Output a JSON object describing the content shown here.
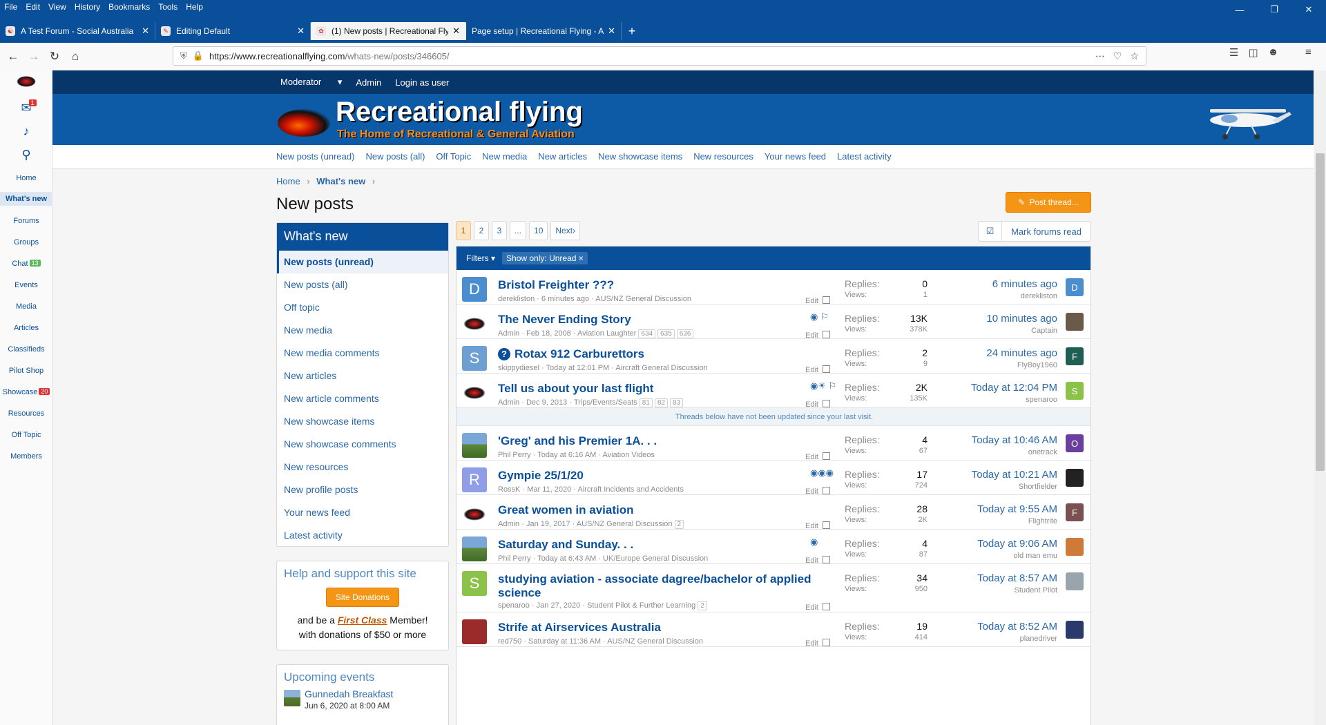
{
  "browser": {
    "menu": [
      "File",
      "Edit",
      "View",
      "History",
      "Bookmarks",
      "Tools",
      "Help"
    ],
    "tabs": [
      {
        "title": "A Test Forum - Social Australia"
      },
      {
        "title": "Editing Default"
      },
      {
        "title": "(1) New posts | Recreational Fly"
      },
      {
        "title": "Page setup | Recreational Flying - A"
      }
    ],
    "url_host": "https://www.recreationalflying.com",
    "url_path": "/whats-new/posts/346605/"
  },
  "rail": {
    "items": [
      "Home",
      "What's new",
      "Forums",
      "Groups",
      "Chat",
      "Events",
      "Media",
      "Articles",
      "Classifieds",
      "Pilot Shop",
      "Showcase",
      "Resources",
      "Off Topic",
      "Members"
    ],
    "chat_badge": "13",
    "showcase_badge": "20",
    "mail_badge": "1"
  },
  "site": {
    "top_links": [
      "Moderator",
      "Admin",
      "Login as user"
    ],
    "logo_title": "Recreational flying",
    "logo_sub": "The Home of Recreational & General Aviation",
    "subnav": [
      "New posts (unread)",
      "New posts (all)",
      "Off Topic",
      "New media",
      "New articles",
      "New showcase items",
      "New resources",
      "Your news feed",
      "Latest activity"
    ],
    "crumbs": {
      "home": "Home",
      "current": "What's new"
    },
    "page_title": "New posts",
    "post_thread": "Post thread...",
    "mark_read": "Mark forums read"
  },
  "sidebar": {
    "whats_new_title": "What's new",
    "items": [
      "New posts (unread)",
      "New posts (all)",
      "Off topic",
      "New media",
      "New media comments",
      "New articles",
      "New article comments",
      "New showcase items",
      "New showcase comments",
      "New resources",
      "New profile posts",
      "Your news feed",
      "Latest activity"
    ],
    "help_title": "Help and support this site",
    "donate_btn": "Site Donations",
    "donate_pre": "and be a ",
    "donate_em": "First Class",
    "donate_post": " Member!",
    "donate_line2": "with donations of $50 or more",
    "events_title": "Upcoming events",
    "event_name": "Gunnedah Breakfast",
    "event_date": "Jun 6, 2020 at 8:00 AM"
  },
  "pager": {
    "pages": [
      "1",
      "2",
      "3",
      "...",
      "10"
    ],
    "next": "Next"
  },
  "filters": {
    "label": "Filters",
    "chip": "Show only: Unread"
  },
  "labels": {
    "replies": "Replies:",
    "views": "Views:",
    "edit": "Edit"
  },
  "divider_text": "Threads below have not been updated since your last visit.",
  "threads": [
    {
      "title": "Bristol Freighter ???",
      "author": "derekliston",
      "date": "6 minutes ago",
      "forum": "AUS/NZ General Discussion",
      "pages": [],
      "replies": "0",
      "views": "1",
      "last_time": "6 minutes ago",
      "last_user": "derekliston",
      "avatar": "D",
      "avatar_color": "#4a8ed0",
      "last_avatar": "D",
      "last_color": "#4a8ed0"
    },
    {
      "title": "The Never Ending Story",
      "author": "Admin",
      "date": "Feb 18, 2008",
      "forum": "Aviation Laughter",
      "pages": [
        "634",
        "635",
        "636"
      ],
      "replies": "13K",
      "views": "378K",
      "last_time": "10 minutes ago",
      "last_user": "Captain",
      "avatar": "",
      "avatar_color": "logo",
      "last_avatar": "",
      "last_color": "#6b5a4a"
    },
    {
      "title": "Rotax 912 Carburettors",
      "author": "skippydiesel",
      "date": "Today at 12:01 PM",
      "forum": "Aircraft General Discussion",
      "pages": [],
      "replies": "2",
      "views": "9",
      "last_time": "24 minutes ago",
      "last_user": "FlyBoy1960",
      "avatar": "S",
      "avatar_color": "#6e9fd3",
      "last_avatar": "F",
      "last_color": "#1f5e52"
    },
    {
      "title": "Tell us about your last flight",
      "author": "Admin",
      "date": "Dec 9, 2013",
      "forum": "Trips/Events/Seats",
      "pages": [
        "81",
        "82",
        "83"
      ],
      "replies": "2K",
      "views": "135K",
      "last_time": "Today at 12:04 PM",
      "last_user": "spenaroo",
      "avatar": "",
      "avatar_color": "logo",
      "last_avatar": "S",
      "last_color": "#8bc34a"
    },
    {
      "title": "'Greg' and his Premier 1A. . .",
      "author": "Phil Perry",
      "date": "Today at 6:16 AM",
      "forum": "Aviation Videos",
      "pages": [],
      "replies": "4",
      "views": "67",
      "last_time": "Today at 10:46 AM",
      "last_user": "onetrack",
      "avatar": "",
      "avatar_color": "photo",
      "last_avatar": "O",
      "last_color": "#6a3fa0"
    },
    {
      "title": "Gympie 25/1/20",
      "author": "RossK",
      "date": "Mar 11, 2020",
      "forum": "Aircraft Incidents and Accidents",
      "pages": [],
      "replies": "17",
      "views": "724",
      "last_time": "Today at 10:21 AM",
      "last_user": "Shortfielder",
      "avatar": "R",
      "avatar_color": "#8f9ee6",
      "last_avatar": "",
      "last_color": "#222222"
    },
    {
      "title": "Great women in aviation",
      "author": "Admin",
      "date": "Jan 19, 2017",
      "forum": "AUS/NZ General Discussion",
      "pages": [
        "2"
      ],
      "replies": "28",
      "views": "2K",
      "last_time": "Today at 9:55 AM",
      "last_user": "Flightrite",
      "avatar": "",
      "avatar_color": "logo",
      "last_avatar": "F",
      "last_color": "#7a5050"
    },
    {
      "title": "Saturday and Sunday. . .",
      "author": "Phil Perry",
      "date": "Today at 6:43 AM",
      "forum": "UK/Europe General Discussion",
      "pages": [],
      "replies": "4",
      "views": "87",
      "last_time": "Today at 9:06 AM",
      "last_user": "old man emu",
      "avatar": "",
      "avatar_color": "photo",
      "last_avatar": "",
      "last_color": "#d07a3a"
    },
    {
      "title": "studying aviation - associate dagree/bachelor of applied",
      "title2": "science",
      "author": "spenaroo",
      "date": "Jan 27, 2020",
      "forum": "Student Pilot & Further Learning",
      "pages": [
        "2"
      ],
      "replies": "34",
      "views": "950",
      "last_time": "Today at 8:57 AM",
      "last_user": "Student Pilot",
      "avatar": "S",
      "avatar_color": "#8bc34a",
      "last_avatar": "",
      "last_color": "#9aa4ad"
    },
    {
      "title": "Strife at Airservices Australia",
      "author": "red750",
      "date": "Saturday at 11:36 AM",
      "forum": "AUS/NZ General Discussion",
      "pages": [],
      "replies": "19",
      "views": "414",
      "last_time": "Today at 8:52 AM",
      "last_user": "planedriver",
      "avatar": "",
      "avatar_color": "#9b2a2a",
      "last_avatar": "",
      "last_color": "#2a3a6a"
    }
  ]
}
